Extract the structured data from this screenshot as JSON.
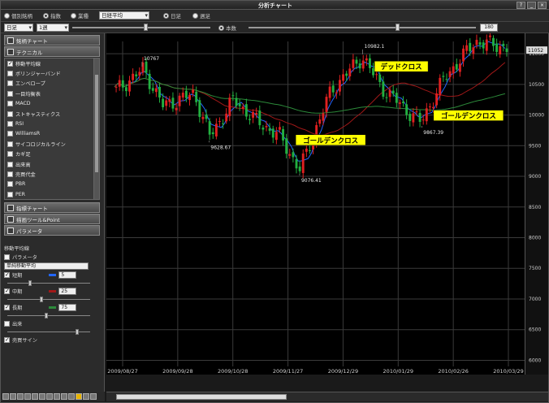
{
  "window": {
    "title": "分析チャート",
    "controls": [
      "?",
      "_",
      "×"
    ]
  },
  "toolbar": {
    "row1": {
      "opt_all_stocks": "個別銘柄",
      "opt_index": "指数",
      "opt_sector": "業種",
      "index_select": "日経平均",
      "opt_daily": "日足",
      "opt_weekly": "週足"
    },
    "row2": {
      "period_select": "日足",
      "span_select": "1週",
      "count_label": "本数",
      "count_value": "180"
    }
  },
  "sidebar": {
    "section1_label": "銘柄チャート",
    "section2_label": "テクニカル",
    "indicators": [
      {
        "label": "移動平均線",
        "checked": true
      },
      {
        "label": "ボリンジャーバンド",
        "checked": false
      },
      {
        "label": "エンベロープ",
        "checked": false
      },
      {
        "label": "一目均衡表",
        "checked": false
      },
      {
        "label": "MACD",
        "checked": false
      },
      {
        "label": "ストキャスティクス",
        "checked": false
      },
      {
        "label": "RSI",
        "checked": false
      },
      {
        "label": "WilliamsR",
        "checked": false
      },
      {
        "label": "サイコロジカルライン",
        "checked": false
      },
      {
        "label": "カギ足",
        "checked": false
      },
      {
        "label": "出来高",
        "checked": false
      },
      {
        "label": "売買代金",
        "checked": false
      },
      {
        "label": "PBR",
        "checked": false
      },
      {
        "label": "PER",
        "checked": false
      }
    ],
    "section3_label": "指標チャート",
    "section4_label": "描画ツール&Point",
    "section5_label": "パラメータ",
    "settings": {
      "title": "移動平均線",
      "subtitle": "パラメータ",
      "ma_type": "単純移動平均",
      "short_label": "短期",
      "short_value": "5",
      "mid_label": "中期",
      "mid_value": "25",
      "long_label": "長期",
      "long_value": "75",
      "volume_label": "出来",
      "signal_label": "売買サイン"
    }
  },
  "chart_data": {
    "type": "candlestick",
    "x_ticks": [
      "2009/08/27",
      "2009/09/28",
      "2009/10/28",
      "2009/11/27",
      "2009/12/29",
      "2010/01/29",
      "2010/02/26",
      "2010/03/29"
    ],
    "y_ticks": [
      11000,
      10500,
      10000,
      9500,
      9000,
      8500,
      8000,
      7500,
      7000,
      6500,
      6000
    ],
    "price_box": "11052",
    "ylim": [
      5900,
      11200
    ],
    "annotations": [
      {
        "text": "10767",
        "kind": "peak"
      },
      {
        "text": "9628.67",
        "kind": "trough"
      },
      {
        "text": "9076.41",
        "kind": "trough"
      },
      {
        "text": "10982.1",
        "kind": "peak"
      },
      {
        "text": "9867.39",
        "kind": "trough"
      }
    ],
    "callouts": [
      {
        "text": "デッドクロス"
      },
      {
        "text": "ゴールデンクロス"
      },
      {
        "text": "ゴールデンクロス"
      }
    ],
    "series": [
      {
        "color": "#2266ff"
      },
      {
        "color": "#a01818"
      },
      {
        "color": "#2c8a3a"
      }
    ]
  }
}
